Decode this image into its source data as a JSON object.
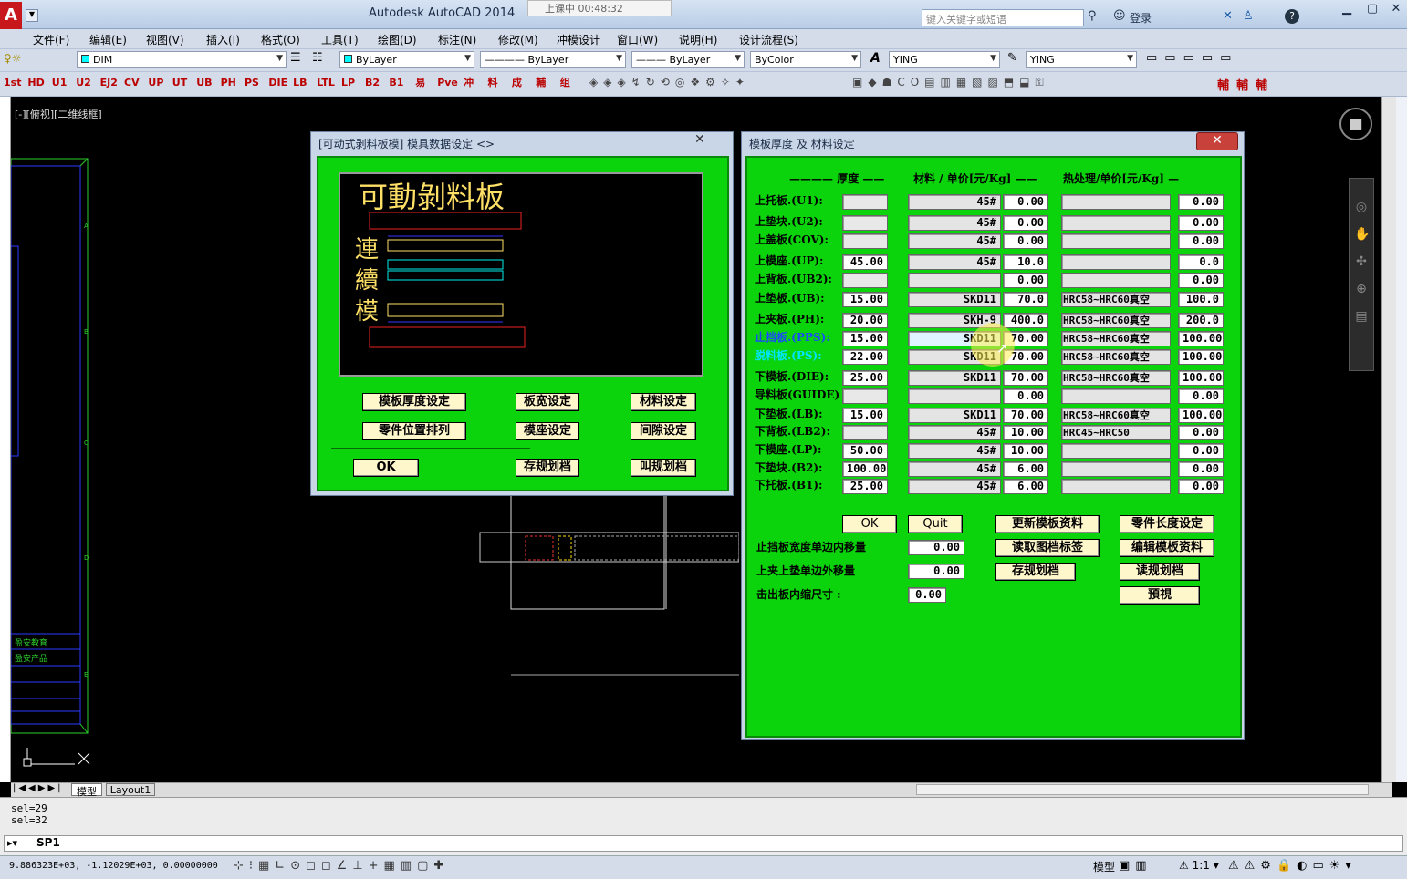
{
  "window": {
    "title": "Autodesk AutoCAD 2014",
    "search_placeholder": "键入关键字或短语",
    "login": "登录",
    "recording": "上课中 00:48:32"
  },
  "menu": [
    "文件(F)",
    "编辑(E)",
    "视图(V)",
    "插入(I)",
    "格式(O)",
    "工具(T)",
    "绘图(D)",
    "标注(N)",
    "修改(M)",
    "冲模设计",
    "窗口(W)",
    "说明(H)",
    "设计流程(S)"
  ],
  "toolbar": {
    "layer": "DIM",
    "color": "ByLayer",
    "linetype": "ByLayer",
    "lineweight": "ByLayer",
    "plotstyle": "ByColor",
    "textstyle": "YING",
    "dimstyle": "YING",
    "icons": [
      "1st",
      "HD",
      "U1",
      "U2",
      "EJ2",
      "CV",
      "UP",
      "UT",
      "UB",
      "PH",
      "PS",
      "DIE",
      "LB",
      "LTL",
      "LP",
      "B2",
      "B1",
      "易",
      "Pve",
      "冲",
      "料",
      "成",
      "輔",
      "组"
    ]
  },
  "viewport": {
    "label": "[-][俯视][二维线框]"
  },
  "title_block": [
    "盈安教育",
    "盈安产品"
  ],
  "dialog1": {
    "title": "[可动式剥料板模] 模具数据设定 <>",
    "preview_title": "可動剝料板",
    "preview_side": [
      "連",
      "續",
      "模"
    ],
    "buttons": {
      "plate_thickness": "模板厚度设定",
      "plate_width": "板宽设定",
      "material": "材料设定",
      "part_position": "零件位置排列",
      "die_base": "模座设定",
      "clearance": "间隙设定",
      "ok": "OK",
      "save_spec": "存规划档",
      "load_spec": "叫规划档"
    }
  },
  "dialog2": {
    "title": "模板厚度 及 材料设定",
    "headers": {
      "thickness": "厚度",
      "material_price": "材料 / 单价[元/Kg]",
      "heat_price": "热处理/单价[元/Kg]"
    },
    "rows": [
      {
        "label": "上托板.(U1):",
        "thickness": "",
        "material": "45#",
        "price": "0.00",
        "heat": "",
        "heat_price": "0.00"
      },
      {
        "label": "上垫块.(U2):",
        "thickness": "",
        "material": "45#",
        "price": "0.00",
        "heat": "",
        "heat_price": "0.00"
      },
      {
        "label": "上盖板(COV):",
        "thickness": "",
        "material": "45#",
        "price": "0.00",
        "heat": "",
        "heat_price": "0.00"
      },
      {
        "label": "上模座.(UP):",
        "thickness": "45.00",
        "material": "45#",
        "price": "10.0",
        "heat": "",
        "heat_price": "0.0"
      },
      {
        "label": "上背板.(UB2):",
        "thickness": "",
        "material": "",
        "price": "0.00",
        "heat": "",
        "heat_price": "0.00"
      },
      {
        "label": "上垫板.(UB):",
        "thickness": "15.00",
        "material": "SKD11",
        "price": "70.0",
        "heat": "HRC58~HRC60真空",
        "heat_price": "100.0"
      },
      {
        "label": "上夹板.(PH):",
        "thickness": "20.00",
        "material": "SKH-9",
        "price": "400.0",
        "heat": "HRC58~HRC60真空",
        "heat_price": "200.0"
      },
      {
        "label": "止挡板.(PPS):",
        "thickness": "15.00",
        "material": "SKD11",
        "price": "70.00",
        "heat": "HRC58~HRC60真空",
        "heat_price": "100.00"
      },
      {
        "label": "脱料板.(PS):",
        "thickness": "22.00",
        "material": "SKD11",
        "price": "70.00",
        "heat": "HRC58~HRC60真空",
        "heat_price": "100.00"
      },
      {
        "label": "下模板.(DIE):",
        "thickness": "25.00",
        "material": "SKD11",
        "price": "70.00",
        "heat": "HRC58~HRC60真空",
        "heat_price": "100.00"
      },
      {
        "label": "导料板(GUIDE)",
        "thickness": "",
        "material": "",
        "price": "0.00",
        "heat": "",
        "heat_price": "0.00"
      },
      {
        "label": "下垫板.(LB):",
        "thickness": "15.00",
        "material": "SKD11",
        "price": "70.00",
        "heat": "HRC58~HRC60真空",
        "heat_price": "100.00"
      },
      {
        "label": "下背板.(LB2):",
        "thickness": "",
        "material": "45#",
        "price": "10.00",
        "heat": "HRC45~HRC50",
        "heat_price": "0.00"
      },
      {
        "label": "下模座.(LP):",
        "thickness": "50.00",
        "material": "45#",
        "price": "10.00",
        "heat": "",
        "heat_price": "0.00"
      },
      {
        "label": "下垫块.(B2):",
        "thickness": "100.00",
        "material": "45#",
        "price": "6.00",
        "heat": "",
        "heat_price": "0.00"
      },
      {
        "label": "下托板.(B1):",
        "thickness": "25.00",
        "material": "45#",
        "price": "6.00",
        "heat": "",
        "heat_price": "0.00"
      }
    ],
    "buttons": {
      "ok": "OK",
      "quit": "Quit",
      "update": "更新模板资料",
      "part_length": "零件长度设定",
      "read_tag": "读取图档标签",
      "edit_data": "编辑模板资料",
      "save_spec": "存规划档",
      "read_spec": "读规划档",
      "preview": "預視"
    },
    "offsets": [
      {
        "label": "止挡板宽度单边内移量",
        "value": "0.00"
      },
      {
        "label": "上夹上垫单边外移量",
        "value": "0.00"
      },
      {
        "label": "击出板内缩尺寸 :",
        "value": "0.00"
      }
    ]
  },
  "tabs": {
    "model": "模型",
    "layout": "Layout1"
  },
  "command": {
    "lines": [
      "sel=29",
      "sel=32"
    ],
    "prompt": "SP1"
  },
  "status": {
    "coords": "9.886323E+03,  -1.12029E+03,  0.00000000",
    "model": "模型",
    "scale": "1:1"
  }
}
